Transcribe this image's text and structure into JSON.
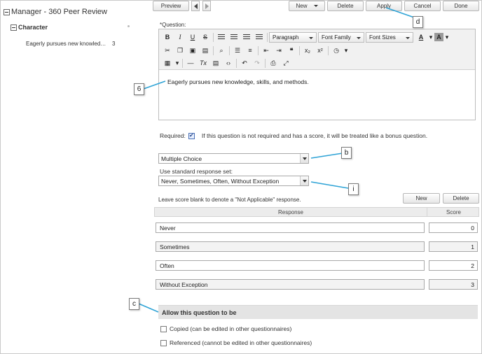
{
  "tree": {
    "root_label": "Manager - 360 Peer Review",
    "category_label": "Character",
    "item_label": "Eagerly pursues new knowledge, skills, and methods.",
    "item_score": "3"
  },
  "toolbar": {
    "preview": "Preview",
    "new": "New",
    "delete": "Delete",
    "apply": "Apply",
    "cancel": "Cancel",
    "done": "Done"
  },
  "editor": {
    "label": "*Question:",
    "paragraph": "Paragraph",
    "font_family": "Font Family",
    "font_sizes": "Font Sizes",
    "content": "Eagerly pursues new knowledge, skills, and methods."
  },
  "required": {
    "label": "Required:",
    "checked": true,
    "note": "If this question is not required and has a score, it will be treated like a bonus question."
  },
  "question_type": {
    "selected": "Multiple Choice"
  },
  "response_set": {
    "label": "Use standard response set:",
    "selected": "Never, Sometimes, Often, Without Exception"
  },
  "responses": {
    "hint": "Leave score blank to denote a \"Not Applicable\" response.",
    "new_label": "New",
    "delete_label": "Delete",
    "headers": {
      "response": "Response",
      "score": "Score"
    },
    "rows": [
      {
        "response": "Never",
        "score": "0"
      },
      {
        "response": "Sometimes",
        "score": "1"
      },
      {
        "response": "Often",
        "score": "2"
      },
      {
        "response": "Without Exception",
        "score": "3"
      }
    ]
  },
  "allow": {
    "title": "Allow this question to be",
    "options": [
      {
        "label": "Copied (can be edited in other questionnaires)",
        "checked": false
      },
      {
        "label": "Referenced (cannot be edited in other questionnaires)",
        "checked": false
      }
    ]
  },
  "callouts": {
    "d": "d",
    "six": "6",
    "b": "b",
    "i": "i",
    "c": "c"
  },
  "colors": {
    "callout_line": "#2ea3d6",
    "header_bg": "#e4e4e4"
  }
}
